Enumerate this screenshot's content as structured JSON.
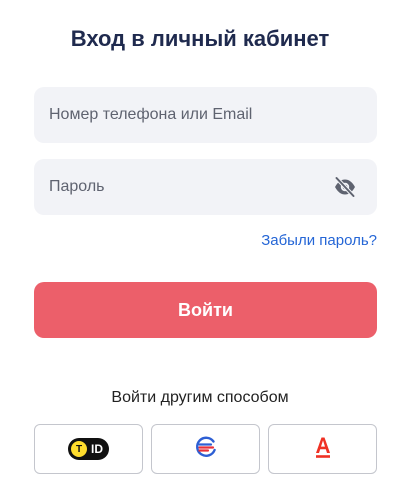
{
  "login": {
    "title": "Вход в личный кабинет",
    "login_field": {
      "placeholder": "Номер телефона или Email",
      "value": ""
    },
    "password_field": {
      "placeholder": "Пароль",
      "value": "",
      "toggle_icon": "eye-off-icon"
    },
    "forgot_link": "Забыли пароль?",
    "submit_label": "Войти",
    "alt_login_title": "Войти другим способом",
    "providers": [
      {
        "name": "tinkoff-id",
        "icon": "tinkoff-id-logo",
        "label": "ID",
        "badge_letter": "T"
      },
      {
        "name": "sber",
        "icon": "sber-id-logo"
      },
      {
        "name": "alfa",
        "icon": "alfa-logo"
      }
    ]
  },
  "colors": {
    "title": "#1f2a4e",
    "field_bg": "#f2f3f7",
    "link": "#2566d6",
    "primary": "#ec5f6a",
    "border": "#c4c6cd",
    "alfa_red": "#ef3124",
    "sber_blue": "#2d5fd4",
    "sber_red": "#e8303a"
  }
}
